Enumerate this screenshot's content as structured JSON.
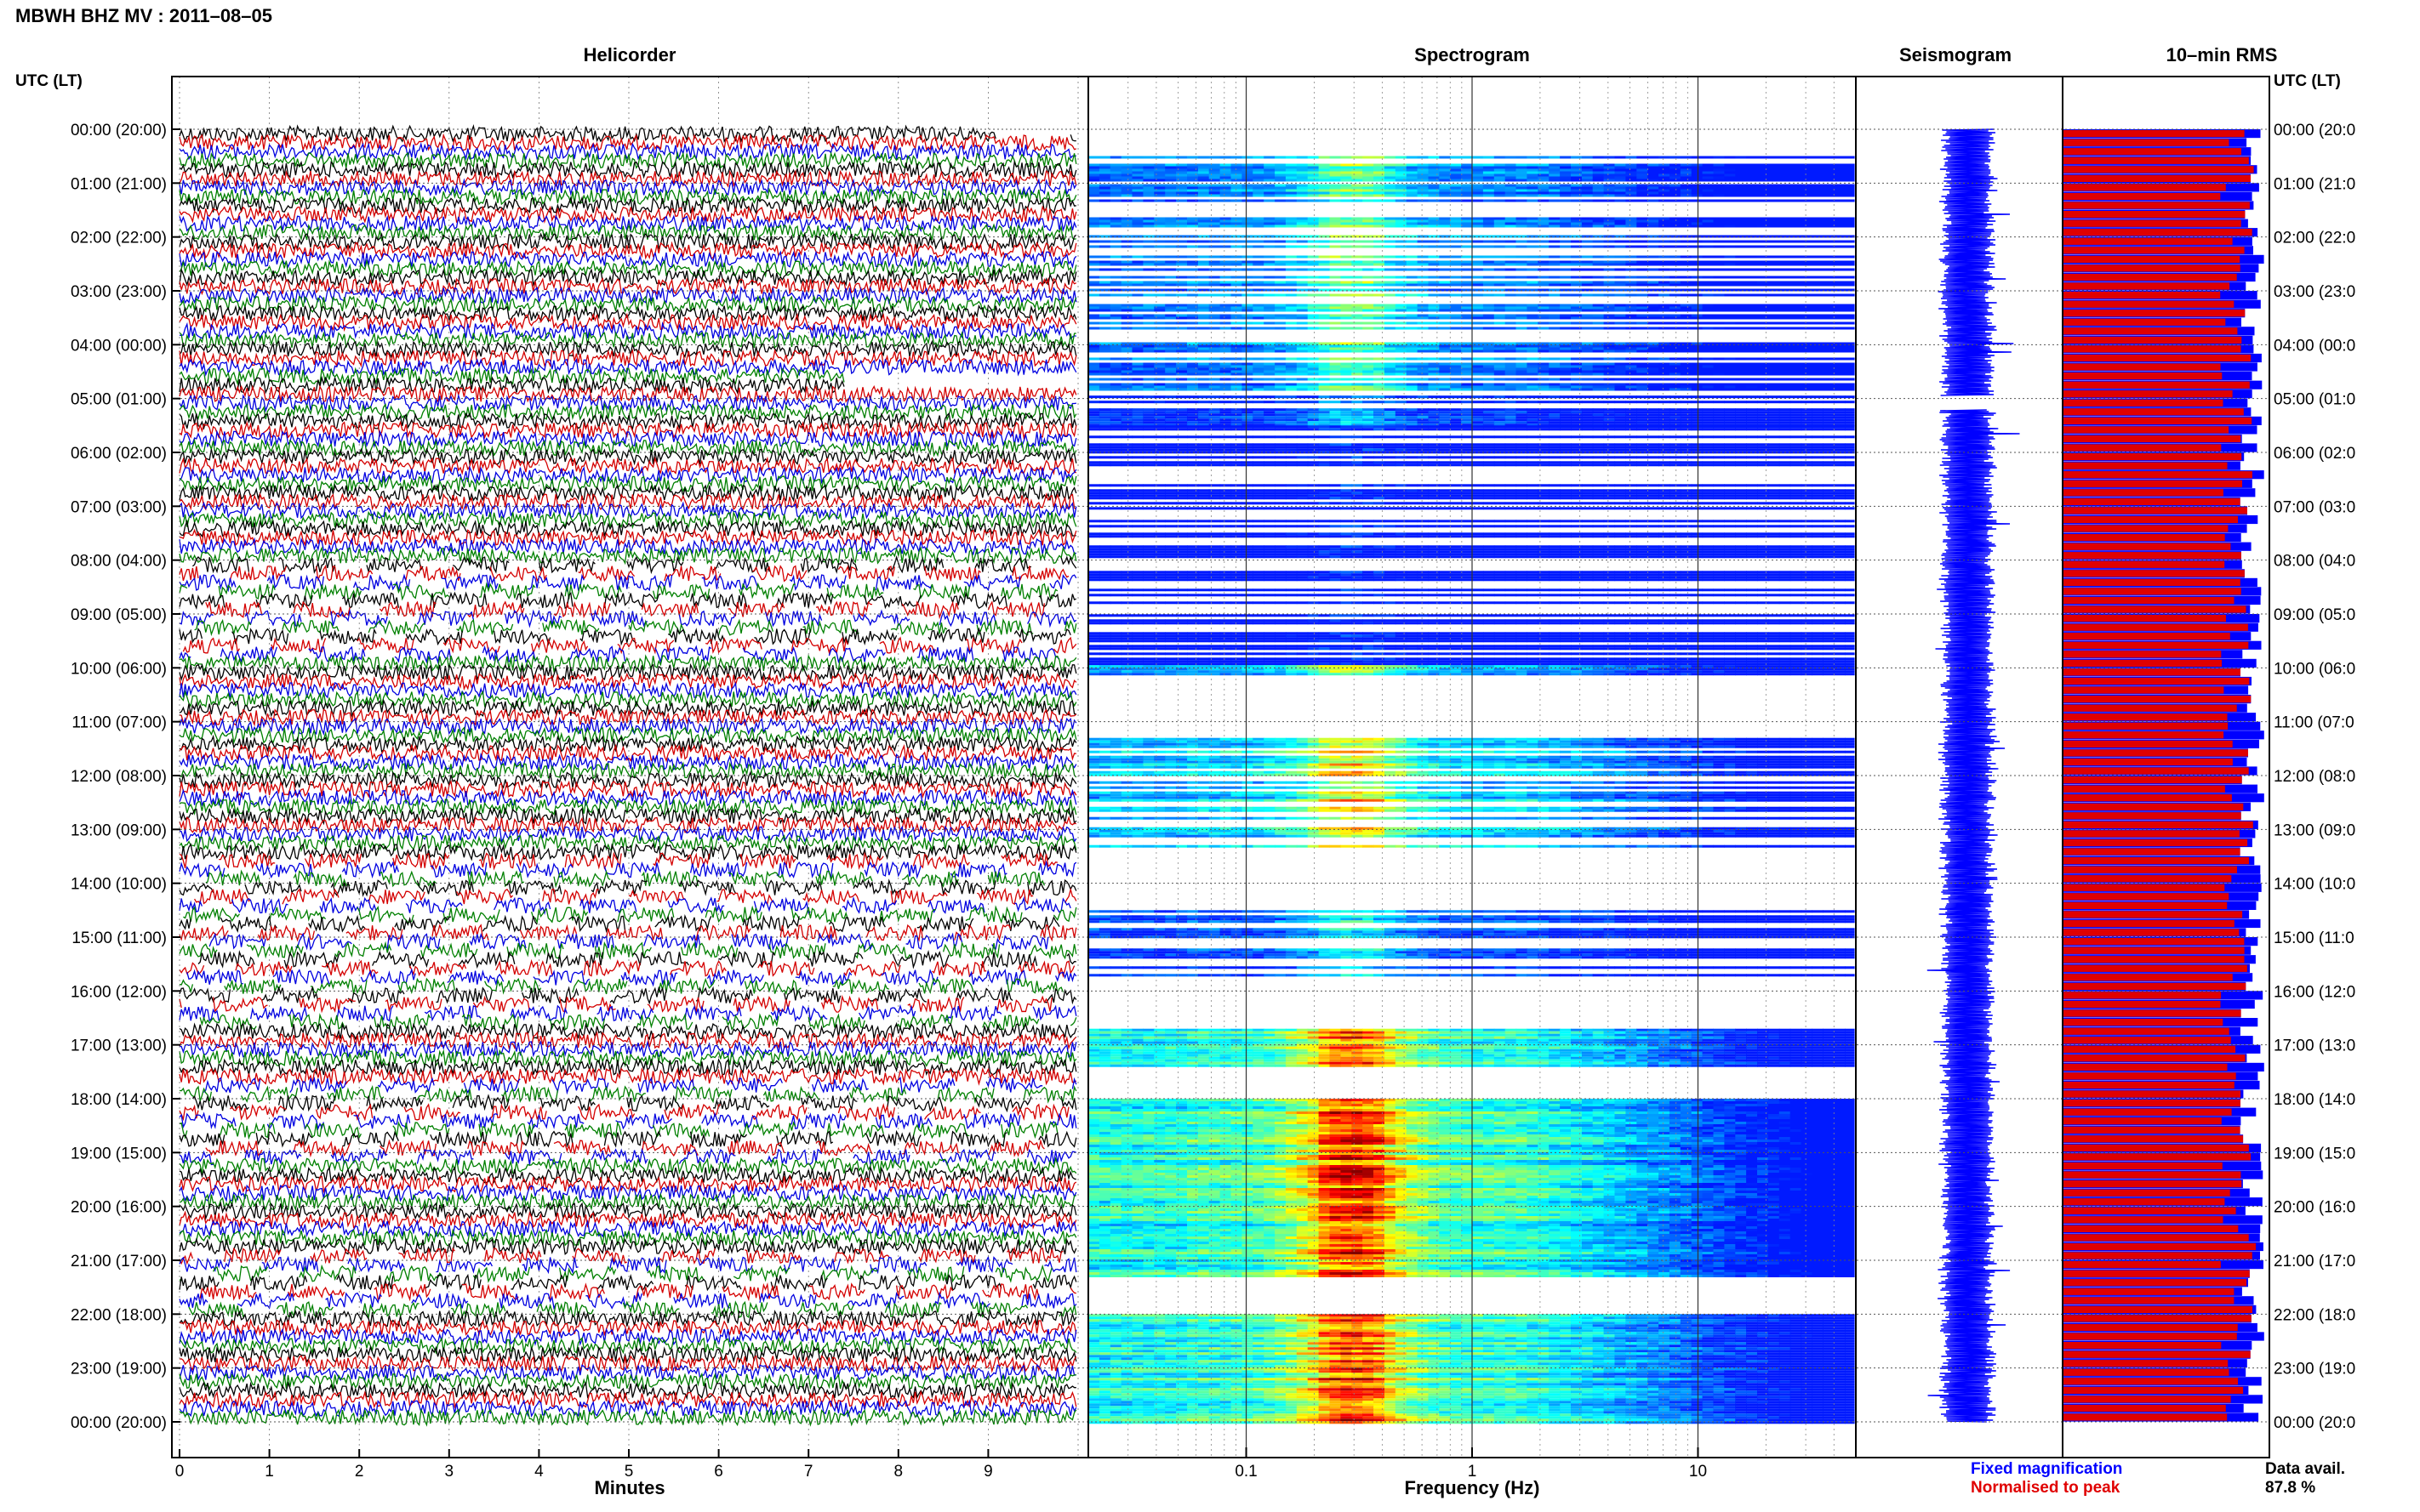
{
  "header": {
    "title": "MBWH BHZ MV : 2011–08–05",
    "left_axis_label": "UTC (LT)",
    "right_axis_label": "UTC (LT)"
  },
  "panels": {
    "helicorder": "Helicorder",
    "spectrogram": "Spectrogram",
    "seismogram": "Seismogram",
    "rms": "10–min RMS"
  },
  "time_labels": [
    "00:00 (20:00)",
    "01:00 (21:00)",
    "02:00 (22:00)",
    "03:00 (23:00)",
    "04:00 (00:00)",
    "05:00 (01:00)",
    "06:00 (02:00)",
    "07:00 (03:00)",
    "08:00 (04:00)",
    "09:00 (05:00)",
    "10:00 (06:00)",
    "11:00 (07:00)",
    "12:00 (08:00)",
    "13:00 (09:00)",
    "14:00 (10:00)",
    "15:00 (11:00)",
    "16:00 (12:00)",
    "17:00 (13:00)",
    "18:00 (14:00)",
    "19:00 (15:00)",
    "20:00 (16:00)",
    "21:00 (17:00)",
    "22:00 (18:00)",
    "23:00 (19:00)",
    "00:00 (20:00)"
  ],
  "right_time_labels": [
    "00:00 (20:0",
    "01:00 (21:0",
    "02:00 (22:0",
    "03:00 (23:0",
    "04:00 (00:0",
    "05:00 (01:0",
    "06:00 (02:0",
    "07:00 (03:0",
    "08:00 (04:0",
    "09:00 (05:0",
    "10:00 (06:0",
    "11:00 (07:0",
    "12:00 (08:0",
    "13:00 (09:0",
    "14:00 (10:0",
    "15:00 (11:0",
    "16:00 (12:0",
    "17:00 (13:0",
    "18:00 (14:0",
    "19:00 (15:0",
    "20:00 (16:0",
    "21:00 (17:0",
    "22:00 (18:0",
    "23:00 (19:0",
    "00:00 (20:0"
  ],
  "legend": {
    "fixed": "Fixed magnification",
    "normalised": "Normalised to peak",
    "data_avail_label": "Data avail.",
    "data_avail_value": "87.8 %"
  },
  "colors": {
    "trace_black": "#000000",
    "trace_red": "#d40000",
    "trace_blue": "#0000e0",
    "trace_green": "#008000",
    "rms_fixed": "#0000ff",
    "rms_normalised": "#e00000",
    "seismogram": "#0000ff",
    "grid": "#888888"
  },
  "chart_data": [
    {
      "type": "line",
      "panel": "helicorder",
      "title": "Helicorder",
      "xlabel": "Minutes",
      "x_ticks": [
        "0",
        "1",
        "2",
        "3",
        "4",
        "5",
        "6",
        "7",
        "8",
        "9"
      ],
      "xlim": [
        0,
        10
      ],
      "rows_per_hour": 6,
      "hours": 24,
      "trace_color_cycle": [
        "black",
        "red",
        "blue",
        "green"
      ],
      "data_gaps": [
        {
          "row_start": 0,
          "row_end": 0,
          "x_start": 9.1,
          "x_end": 9.9
        },
        {
          "row_start": 27,
          "row_end": 28,
          "x_start": 7.4,
          "x_end": 10
        },
        {
          "row_start": 48,
          "row_end": 58,
          "x_start": 0,
          "x_end": 10,
          "sparse": true
        },
        {
          "row_start": 81,
          "row_end": 99,
          "x_start": 0,
          "x_end": 10,
          "sparse": true
        },
        {
          "row_start": 106,
          "row_end": 114,
          "x_start": 0,
          "x_end": 10,
          "sparse": true
        },
        {
          "row_start": 125,
          "row_end": 131,
          "x_start": 0,
          "x_end": 10,
          "sparse": true
        }
      ]
    },
    {
      "type": "heatmap",
      "panel": "spectrogram",
      "title": "Spectrogram",
      "xlabel": "Frequency (Hz)",
      "x_scale": "log",
      "xlim": [
        0.02,
        50
      ],
      "x_ticks": [
        "0.1",
        "1",
        "10"
      ],
      "x_tick_values": [
        0.1,
        1,
        10
      ],
      "colormap": "jet",
      "peak_band_hz": [
        0.2,
        0.4
      ],
      "intervals_hours": [
        {
          "start": 0.0,
          "end": 0.45,
          "level": 0
        },
        {
          "start": 0.45,
          "end": 4.85,
          "level": 0.45,
          "sparse": true
        },
        {
          "start": 4.85,
          "end": 5.5,
          "level": 0.3,
          "sparse": true
        },
        {
          "start": 5.5,
          "end": 9.95,
          "level": 0.15,
          "sparse": true
        },
        {
          "start": 9.95,
          "end": 10.1,
          "level": 0.5
        },
        {
          "start": 10.1,
          "end": 11.3,
          "level": 0
        },
        {
          "start": 11.3,
          "end": 13.3,
          "level": 0.6,
          "sparse": true
        },
        {
          "start": 13.3,
          "end": 14.5,
          "level": 0
        },
        {
          "start": 14.5,
          "end": 15.7,
          "level": 0.35,
          "sparse": true
        },
        {
          "start": 15.7,
          "end": 16.7,
          "level": 0
        },
        {
          "start": 16.7,
          "end": 17.4,
          "level": 0.7
        },
        {
          "start": 17.4,
          "end": 18.0,
          "level": 0
        },
        {
          "start": 18.0,
          "end": 21.3,
          "level": 0.75
        },
        {
          "start": 21.3,
          "end": 22.0,
          "level": 0
        },
        {
          "start": 22.0,
          "end": 24.0,
          "level": 0.75
        }
      ]
    },
    {
      "type": "line",
      "panel": "seismogram",
      "title": "Seismogram",
      "gaps_hours": [
        [
          4.95,
          5.2
        ]
      ]
    },
    {
      "type": "bar",
      "panel": "rms",
      "title": "10–min RMS",
      "xlabel": "",
      "series": [
        {
          "name": "Fixed magnification",
          "color": "#0000ff"
        },
        {
          "name": "Normalised to peak",
          "color": "#e00000"
        }
      ],
      "bars_per_hour": 6,
      "data_availability_percent": 87.8
    }
  ]
}
